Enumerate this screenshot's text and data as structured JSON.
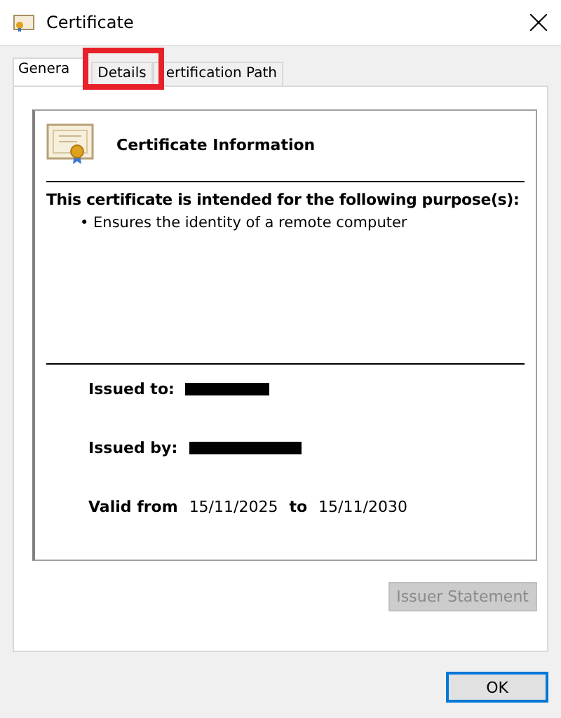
{
  "window": {
    "title": "Certificate"
  },
  "tabs": [
    {
      "label": "Genera",
      "selected": true
    },
    {
      "label": "Details",
      "selected": false
    },
    {
      "label": "ertification Path",
      "selected": false
    }
  ],
  "info": {
    "heading": "Certificate Information",
    "purpose_title": "This certificate is intended for the following purpose(s):",
    "purposes": [
      "• Ensures the identity of a remote computer"
    ],
    "issued_to_label": "Issued to:",
    "issued_by_label": "Issued by:",
    "valid_from_label": "Valid from",
    "valid_from": "15/11/2025",
    "to_label": "to",
    "valid_to": "15/11/2030"
  },
  "issuer_statement": {
    "label": "Issuer Statement",
    "disabled": true
  },
  "ok_button": {
    "label": "OK"
  }
}
